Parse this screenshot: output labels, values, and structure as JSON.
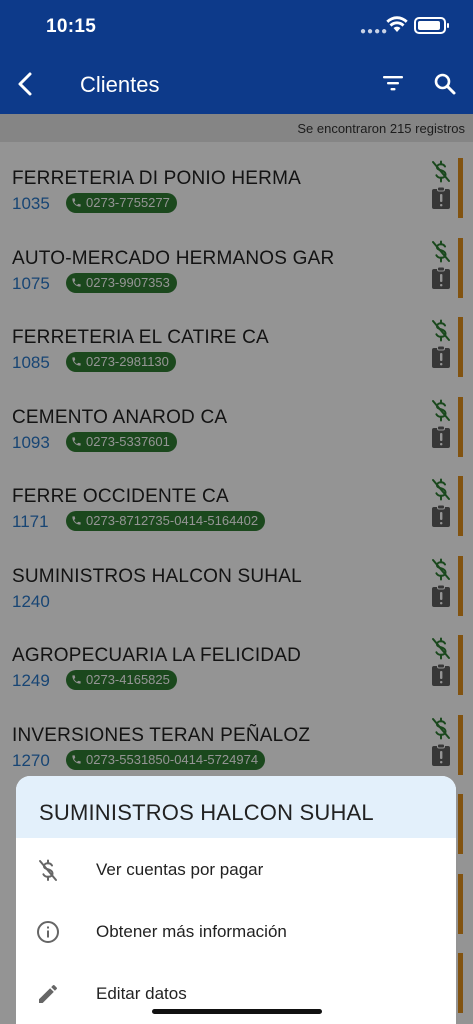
{
  "status": {
    "time": "10:15"
  },
  "appbar": {
    "title": "Clientes"
  },
  "count_text": "Se encontraron 215 registros",
  "clients": [
    {
      "name": "FERRETERIA DI PONIO HERMA",
      "code": "1035",
      "phone": "0273-7755277"
    },
    {
      "name": "AUTO-MERCADO HERMANOS GAR",
      "code": "1075",
      "phone": "0273-9907353"
    },
    {
      "name": "FERRETERIA EL CATIRE CA",
      "code": "1085",
      "phone": "0273-2981130"
    },
    {
      "name": "CEMENTO ANAROD CA",
      "code": "1093",
      "phone": "0273-5337601"
    },
    {
      "name": "FERRE OCCIDENTE CA",
      "code": "1171",
      "phone": "0273-8712735-0414-5164402"
    },
    {
      "name": "SUMINISTROS HALCON SUHAL",
      "code": "1240",
      "phone": null
    },
    {
      "name": "AGROPECUARIA LA FELICIDAD",
      "code": "1249",
      "phone": "0273-4165825"
    },
    {
      "name": "INVERSIONES TERAN PEÑALOZ",
      "code": "1270",
      "phone": "0273-5531850-0414-5724974"
    },
    {
      "name": "",
      "code": "",
      "phone": null
    },
    {
      "name": "",
      "code": "",
      "phone": null
    },
    {
      "name": "",
      "code": "",
      "phone": null
    }
  ],
  "sheet": {
    "title": "SUMINISTROS HALCON SUHAL",
    "items": [
      {
        "label": "Ver cuentas por pagar",
        "icon": "money-off-icon"
      },
      {
        "label": "Obtener más información",
        "icon": "info-icon"
      },
      {
        "label": "Editar datos",
        "icon": "edit-icon"
      }
    ]
  },
  "colors": {
    "appbar": "#0d3a8a",
    "code": "#2a78c8",
    "phone_badge": "#2f7d32",
    "dollar_icon": "#2e7d32",
    "status_stripe": "#e0901c",
    "sheet_header": "#e3f0fb"
  }
}
